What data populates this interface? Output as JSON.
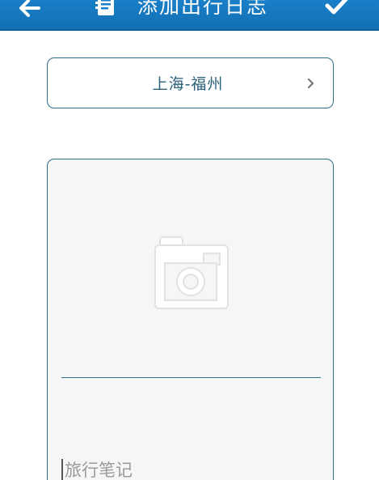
{
  "header": {
    "title": "添加出行日志",
    "back_icon": "arrow-left-icon",
    "doc_icon": "document-icon",
    "confirm_icon": "checkmark-icon"
  },
  "route": {
    "label": "上海-福州",
    "chevron_icon": "chevron-right-icon"
  },
  "entry": {
    "photo_icon": "camera-icon",
    "notes_placeholder": "旅行笔记"
  },
  "colors": {
    "header_bg": "#136fb3",
    "border": "#2f6f86",
    "route_text": "#2a6079",
    "card_bg": "#f5f6f6"
  }
}
